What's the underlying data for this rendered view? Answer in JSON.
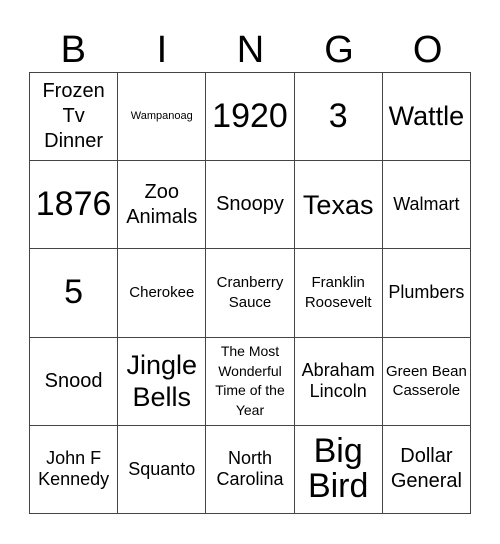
{
  "header": {
    "letters": [
      "B",
      "I",
      "N",
      "G",
      "O"
    ]
  },
  "card": {
    "rows": [
      [
        "Frozen Tv Dinner",
        "Wampanoag",
        "1920",
        "3",
        "Wattle"
      ],
      [
        "1876",
        "Zoo Animals",
        "Snoopy",
        "Texas",
        "Walmart"
      ],
      [
        "5",
        "Cherokee",
        "Cranberry Sauce",
        "Franklin Roosevelt",
        "Plumbers"
      ],
      [
        "Snood",
        "Jingle Bells",
        "The Most Wonderful Time of the Year",
        "Abraham Lincoln",
        "Green Bean Casserole"
      ],
      [
        "John F Kennedy",
        "Squanto",
        "North Carolina",
        "Big Bird",
        "Dollar General"
      ]
    ]
  }
}
